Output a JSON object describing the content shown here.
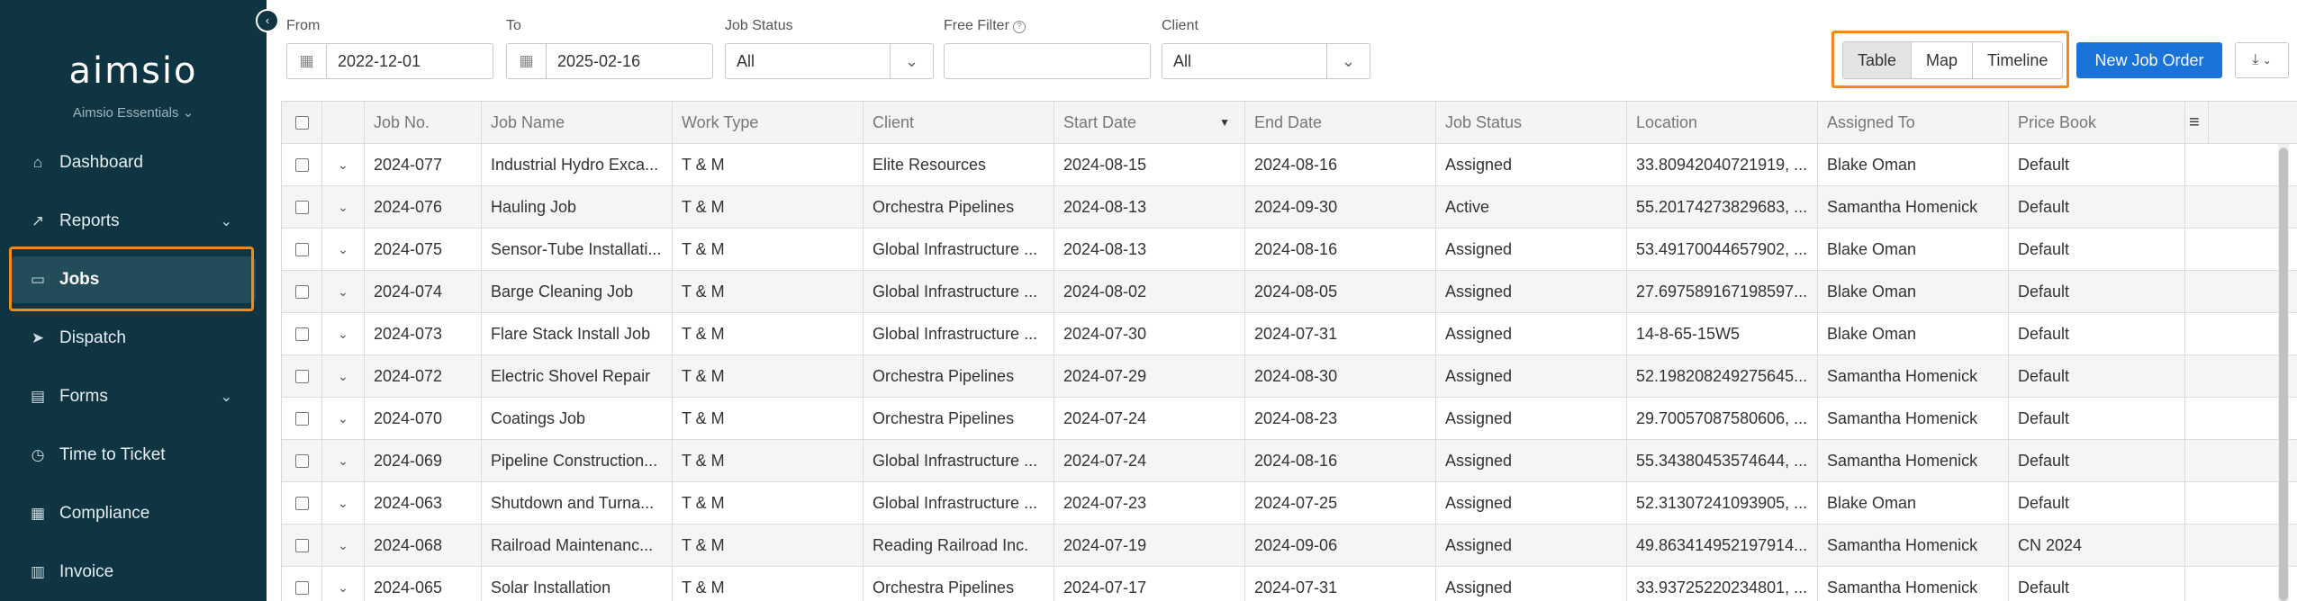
{
  "sidebar": {
    "logo": "aimsio",
    "subtitle": "Aimsio Essentials ⌄",
    "items": [
      {
        "label": "Dashboard",
        "icon": "home-icon"
      },
      {
        "label": "Reports",
        "icon": "chart-icon"
      },
      {
        "label": "Jobs",
        "icon": "folder-icon"
      },
      {
        "label": "Dispatch",
        "icon": "paper-plane-icon"
      },
      {
        "label": "Forms",
        "icon": "clipboard-icon"
      },
      {
        "label": "Time to Ticket",
        "icon": "clock-icon"
      },
      {
        "label": "Compliance",
        "icon": "document-icon"
      },
      {
        "label": "Invoice",
        "icon": "invoice-icon"
      }
    ]
  },
  "filters": {
    "from_label": "From",
    "from_value": "2022-12-01",
    "to_label": "To",
    "to_value": "2025-02-16",
    "status_label": "Job Status",
    "status_value": "All",
    "free_label": "Free Filter",
    "free_value": "",
    "client_label": "Client",
    "client_value": "All"
  },
  "views": {
    "table": "Table",
    "map": "Map",
    "timeline": "Timeline",
    "selected": "Table"
  },
  "actions": {
    "new_job": "New Job Order",
    "download_icon": "download-icon"
  },
  "table": {
    "columns": [
      "Job No.",
      "Job Name",
      "Work Type",
      "Client",
      "Start Date",
      "End Date",
      "Job Status",
      "Location",
      "Assigned To",
      "Price Book"
    ],
    "rows": [
      [
        "2024-077",
        "Industrial Hydro Exca...",
        "T & M",
        "Elite Resources",
        "2024-08-15",
        "2024-08-16",
        "Assigned",
        "33.80942040721919, ...",
        "Blake Oman",
        "Default"
      ],
      [
        "2024-076",
        "Hauling Job",
        "T & M",
        "Orchestra Pipelines",
        "2024-08-13",
        "2024-09-30",
        "Active",
        "55.20174273829683, ...",
        "Samantha Homenick",
        "Default"
      ],
      [
        "2024-075",
        "Sensor-Tube Installati...",
        "T & M",
        "Global Infrastructure ...",
        "2024-08-13",
        "2024-08-16",
        "Assigned",
        "53.49170044657902, ...",
        "Blake Oman",
        "Default"
      ],
      [
        "2024-074",
        "Barge Cleaning Job",
        "T & M",
        "Global Infrastructure ...",
        "2024-08-02",
        "2024-08-05",
        "Assigned",
        "27.697589167198597...",
        "Blake Oman",
        "Default"
      ],
      [
        "2024-073",
        "Flare Stack Install Job",
        "T & M",
        "Global Infrastructure ...",
        "2024-07-30",
        "2024-07-31",
        "Assigned",
        "14-8-65-15W5",
        "Blake Oman",
        "Default"
      ],
      [
        "2024-072",
        "Electric Shovel Repair",
        "T & M",
        "Orchestra Pipelines",
        "2024-07-29",
        "2024-08-30",
        "Assigned",
        "52.198208249275645...",
        "Samantha Homenick",
        "Default"
      ],
      [
        "2024-070",
        "Coatings Job",
        "T & M",
        "Orchestra Pipelines",
        "2024-07-24",
        "2024-08-23",
        "Assigned",
        "29.70057087580606, ...",
        "Samantha Homenick",
        "Default"
      ],
      [
        "2024-069",
        "Pipeline Construction...",
        "T & M",
        "Global Infrastructure ...",
        "2024-07-24",
        "2024-08-16",
        "Assigned",
        "55.34380453574644, ...",
        "Samantha Homenick",
        "Default"
      ],
      [
        "2024-063",
        "Shutdown and Turna...",
        "T & M",
        "Global Infrastructure ...",
        "2024-07-23",
        "2024-07-25",
        "Assigned",
        "52.31307241093905, ...",
        "Blake Oman",
        "Default"
      ],
      [
        "2024-068",
        "Railroad Maintenanc...",
        "T & M",
        "Reading Railroad Inc.",
        "2024-07-19",
        "2024-09-06",
        "Assigned",
        "49.863414952197914...",
        "Samantha Homenick",
        "CN 2024"
      ],
      [
        "2024-065",
        "Solar Installation",
        "T & M",
        "Orchestra Pipelines",
        "2024-07-17",
        "2024-07-31",
        "Assigned",
        "33.93725220234801, ...",
        "Samantha Homenick",
        "Default"
      ]
    ]
  }
}
